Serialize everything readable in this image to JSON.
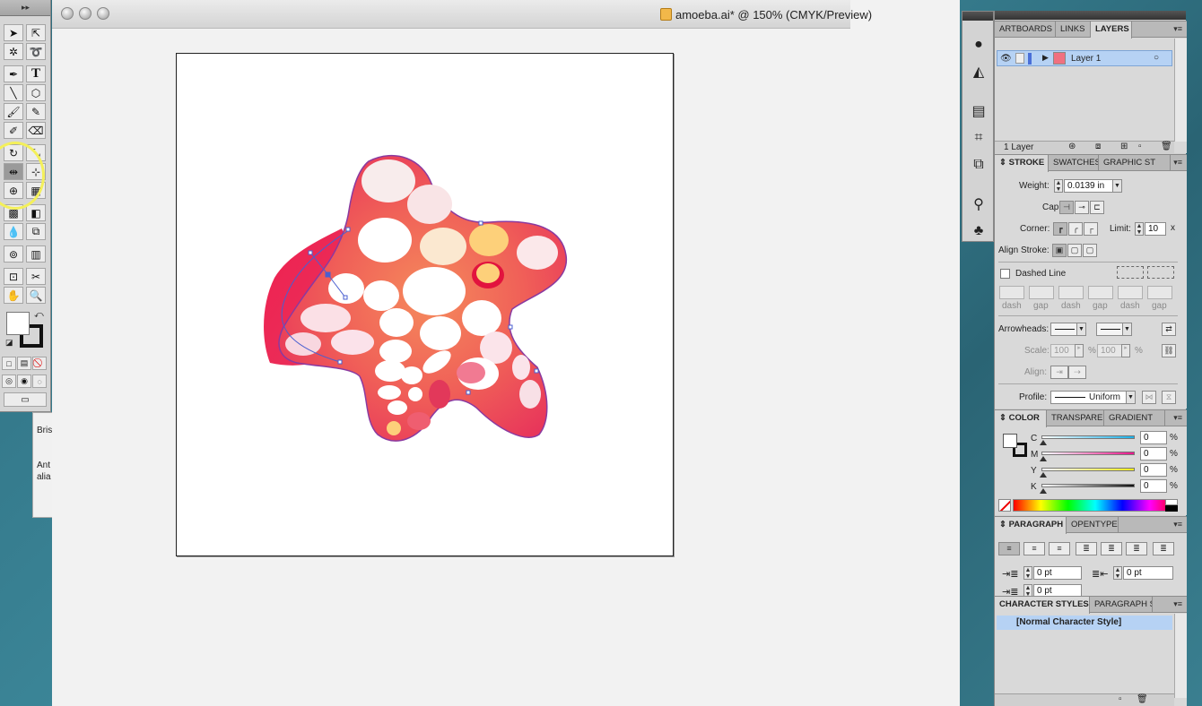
{
  "background_window": {
    "line1": "Bris",
    "line2": "Ant",
    "line3": "alia"
  },
  "document": {
    "title": "amoeba.ai* @ 150% (CMYK/Preview)"
  },
  "colors": {
    "ring": "#f4f05a",
    "selection": "#b6d2f4",
    "path": "#4a5fd0"
  },
  "layers_panel": {
    "tabs": [
      "ARTBOARDS",
      "LINKS",
      "LAYERS"
    ],
    "active_tab": "LAYERS",
    "layer_name": "Layer 1",
    "footer": "1 Layer"
  },
  "stroke_panel": {
    "tabs": [
      "STROKE",
      "SWATCHES",
      "GRAPHIC ST"
    ],
    "weight_label": "Weight:",
    "weight_value": "0.0139 in",
    "cap_label": "Cap:",
    "corner_label": "Corner:",
    "limit_label": "Limit:",
    "limit_value": "10",
    "limit_unit": "x",
    "align_label": "Align Stroke:",
    "dashed_label": "Dashed Line",
    "dash_labels": [
      "dash",
      "gap",
      "dash",
      "gap",
      "dash",
      "gap"
    ],
    "arrowheads_label": "Arrowheads:",
    "scale_label": "Scale:",
    "scale_start": "100",
    "scale_end": "100",
    "percent": "%",
    "align_arrow_label": "Align:",
    "profile_label": "Profile:",
    "profile_value": "Uniform"
  },
  "color_panel": {
    "tabs": [
      "COLOR",
      "TRANSPAREN",
      "GRADIENT"
    ],
    "channels": [
      {
        "label": "C",
        "value": "0"
      },
      {
        "label": "M",
        "value": "0"
      },
      {
        "label": "Y",
        "value": "0"
      },
      {
        "label": "K",
        "value": "0"
      }
    ],
    "percent": "%"
  },
  "paragraph_panel": {
    "tabs": [
      "PARAGRAPH",
      "OPENTYPE"
    ],
    "left_indent": "0 pt",
    "right_indent": "0 pt",
    "first_line_indent": "0 pt"
  },
  "char_styles_panel": {
    "tabs": [
      "CHARACTER STYLES",
      "PARAGRAPH S"
    ],
    "item": "[Normal Character Style]"
  }
}
